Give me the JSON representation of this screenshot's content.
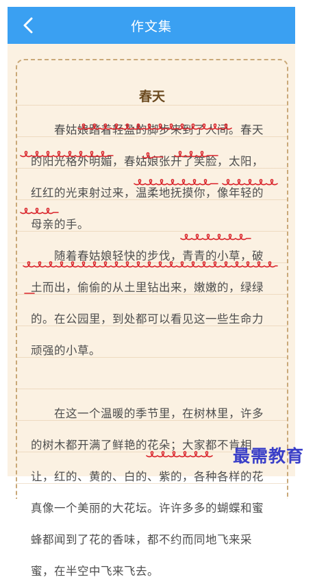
{
  "header": {
    "title": "作文集",
    "back_icon": "chevron-left-icon",
    "color": "#3aa0f2"
  },
  "essay": {
    "title": "春天",
    "lines": [
      "　　春姑娘踏着轻盈的脚步来到了人间。春天",
      "的阳光格外明媚，春姑娘张开了笑脸，太阳，",
      "红红的光束射过来，温柔地抚摸你，像年轻的",
      "母亲的手。",
      "　　随着春姑娘轻快的步伐，青青的小草，破",
      "土而出，偷偷的从土里钻出来，嫩嫩的，绿绿",
      "的。在公园里，到处都可以看见这一些生命力",
      "顽强的小草。",
      "",
      "　　在这一个温暖的季节里，在树林里，许多",
      "的树木都开满了鲜艳的花朵；大家都不肯相",
      "让，红的、黄的、白的、紫的，各种各样的花",
      "真像一个美丽的大花坛。许许多多的蝴蝶和蜜",
      "蜂都闻到了花的香味，都不约而同地飞来采",
      "蜜，在半空中飞来飞去。"
    ]
  },
  "watermark": "最需教育",
  "colors": {
    "underline": "#d9232a",
    "text": "#4e4e4e",
    "paper": "#fbf1e2"
  }
}
